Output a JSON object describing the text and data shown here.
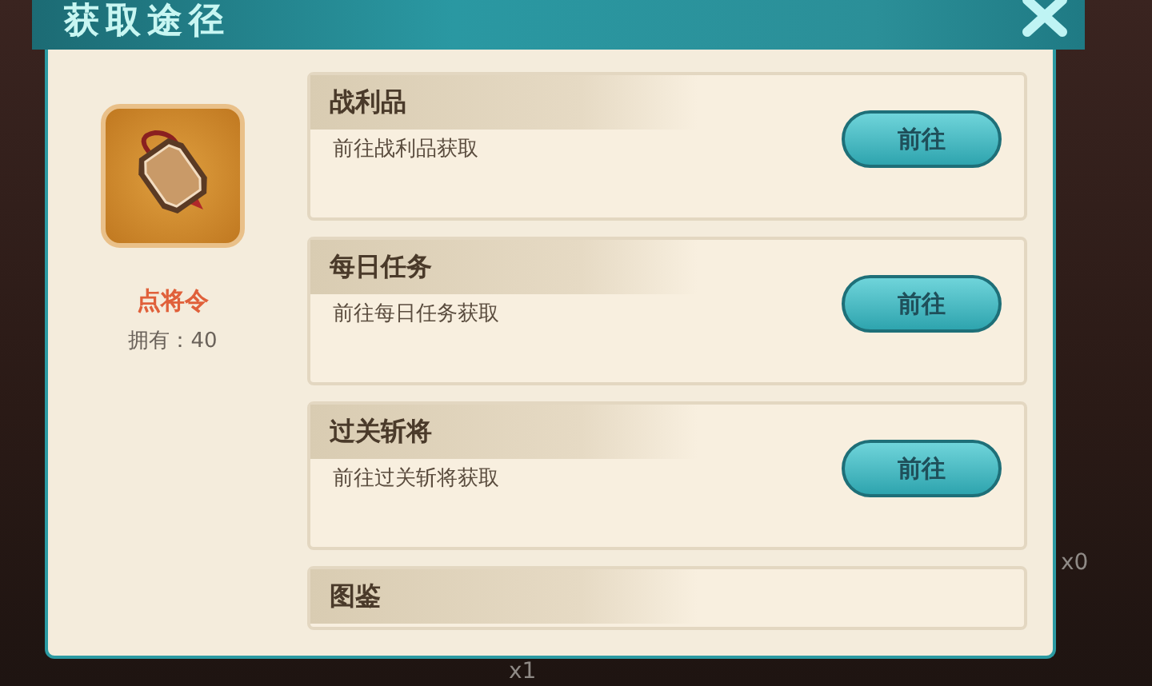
{
  "dialog": {
    "title": "获取途径",
    "item": {
      "name": "点将令",
      "owned": "拥有：40"
    },
    "sources": [
      {
        "title": "战利品",
        "description": "前往战利品获取",
        "button": "前往"
      },
      {
        "title": "每日任务",
        "description": "前往每日任务获取",
        "button": "前往"
      },
      {
        "title": "过关斩将",
        "description": "前往过关斩将获取",
        "button": "前往"
      },
      {
        "title": "图鉴"
      }
    ]
  },
  "background": {
    "counts": [
      "x0",
      "x1"
    ]
  }
}
